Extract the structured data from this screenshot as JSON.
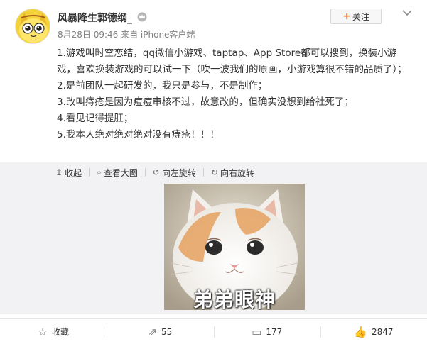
{
  "post": {
    "username": "风暴降生郭德纲_",
    "meta": "8月28日 09:46 来自 iPhone客户端",
    "follow_label": "关注",
    "paragraphs": [
      "1.游戏叫时空恋结，qq微信小游戏、taptap、App Store都可以搜到，换装小游戏，喜欢换装游戏的可以试一下（吹一波我们的原画，小游戏算很不错的品质了）；",
      "2.是前团队一起研发的，我只是参与，不是制作；",
      "3.改叫痔疮是因为痘痘审核不过，故意改的，但确实没想到给社死了；",
      "4.看见记得提肛；",
      "5.我本人绝对绝对绝对没有痔疮！！！"
    ]
  },
  "media": {
    "toolbar": {
      "collapse": "收起",
      "view_large": "查看大图",
      "rotate_left": "向左旋转",
      "rotate_right": "向右旋转"
    },
    "image_caption": "弟弟眼神"
  },
  "actions": {
    "favorite": "收藏",
    "repost_count": "55",
    "comment_count": "177",
    "like_count": "2847"
  },
  "icons": {
    "vip": "crown-icon",
    "menu": "chevron-down-icon",
    "favorite": "star-icon",
    "repost": "share-icon",
    "comment": "comment-icon",
    "like": "thumbs-up-icon"
  },
  "colors": {
    "accent_orange": "#fa7d3c",
    "media_bg": "#f2f2f5"
  }
}
